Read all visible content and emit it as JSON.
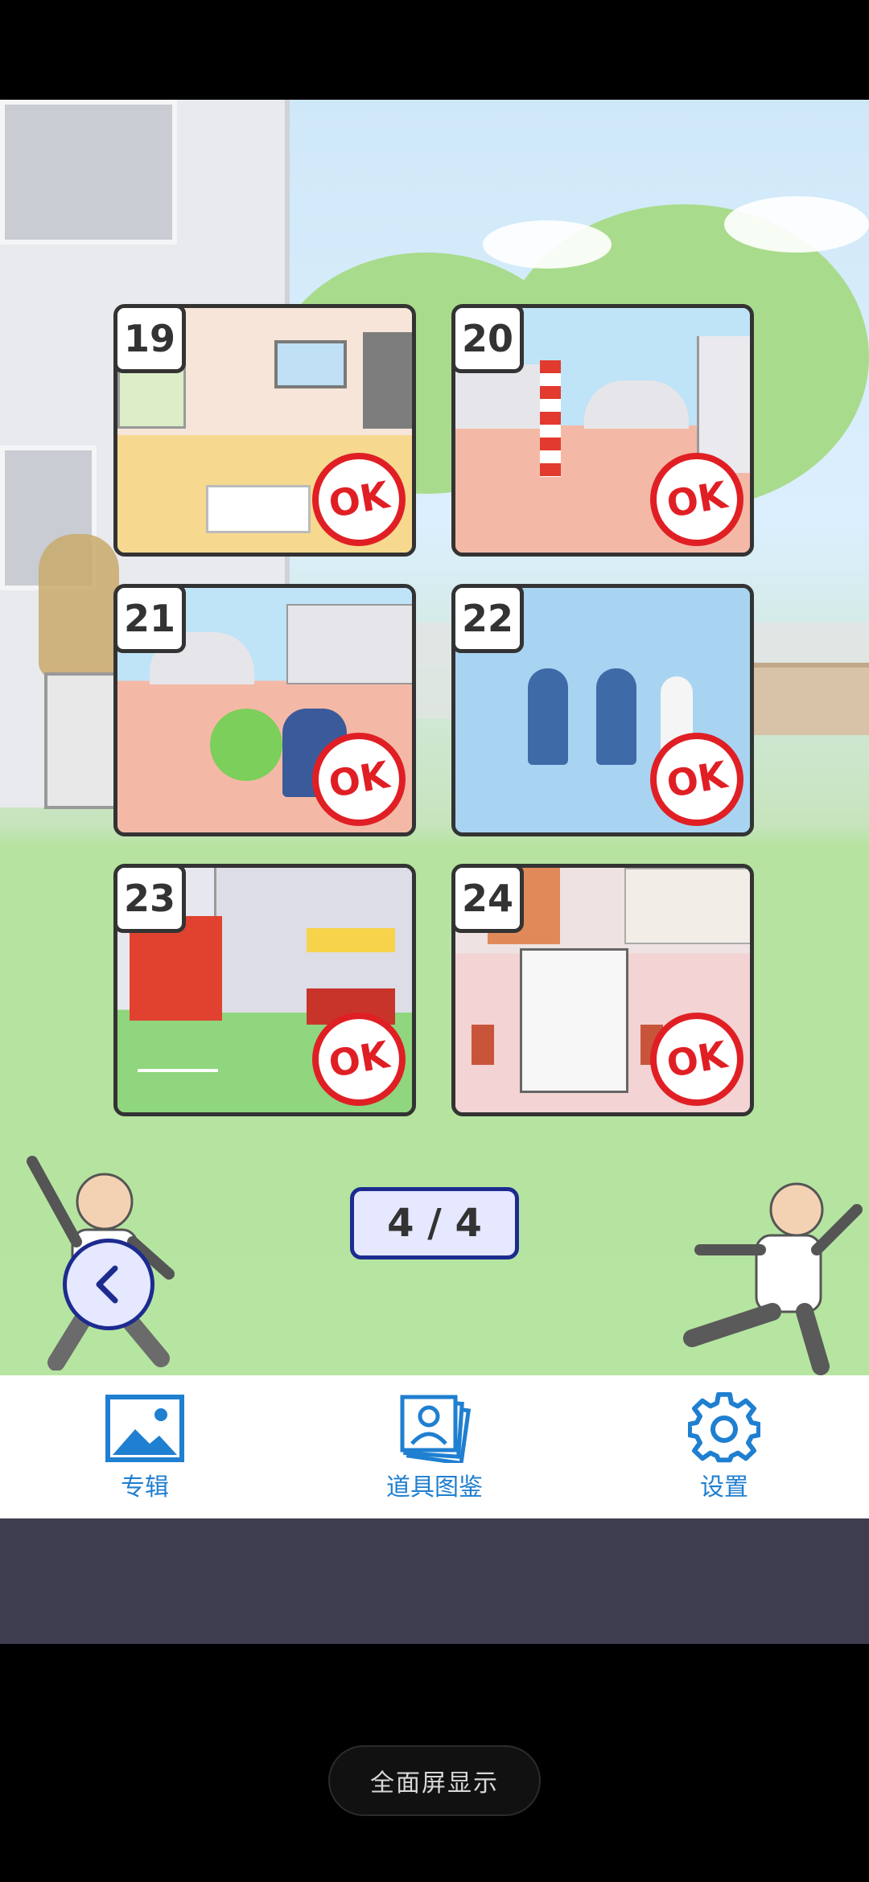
{
  "levels": [
    {
      "number": "19",
      "status": "OK"
    },
    {
      "number": "20",
      "status": "OK"
    },
    {
      "number": "21",
      "status": "OK"
    },
    {
      "number": "22",
      "status": "OK"
    },
    {
      "number": "23",
      "status": "OK"
    },
    {
      "number": "24",
      "status": "OK"
    }
  ],
  "pager": {
    "text": "4 / 4"
  },
  "nav": {
    "items": [
      {
        "label": "专辑",
        "icon": "image-icon"
      },
      {
        "label": "道具图鉴",
        "icon": "photo-stack-icon"
      },
      {
        "label": "设置",
        "icon": "gear-icon"
      }
    ]
  },
  "fullscreen": {
    "label": "全面屏显示"
  },
  "colors": {
    "ok_red": "#e01f25",
    "accent_blue": "#1f7fd0",
    "pager_border": "#1d2b8f"
  }
}
